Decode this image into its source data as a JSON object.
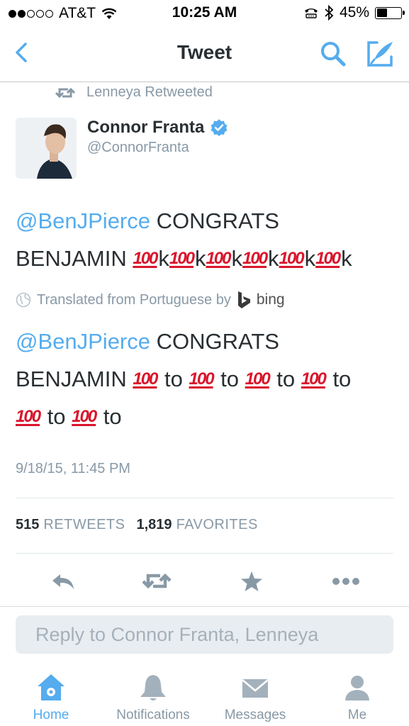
{
  "status_bar": {
    "signal_dots_filled": 2,
    "signal_dots_total": 5,
    "carrier": "AT&T",
    "time": "10:25 AM",
    "battery_percent": "45%",
    "battery_level": 0.45
  },
  "nav": {
    "title": "Tweet",
    "back_icon": "chevron-left-icon",
    "search_icon": "search-icon",
    "compose_icon": "compose-icon",
    "accent_color": "#55acee"
  },
  "tweet": {
    "retweeted_by": "Lenneya Retweeted",
    "author_name": "Connor Franta",
    "author_handle": "@ConnorFranta",
    "verified": true,
    "original": {
      "mention": "@BenJPierce",
      "line1_rest": " CONGRATS",
      "line2_start": "BENJAMIN ",
      "emoji": "100",
      "emoji_suffix": "k",
      "emoji_repeat": 6
    },
    "translated_from": "Translated from Portuguese by",
    "bing": "bing",
    "translation": {
      "mention": "@BenJPierce",
      "line1_rest": " CONGRATS",
      "line2_start": "BENJAMIN ",
      "emoji": "100",
      "emoji_suffix": "to",
      "emoji_repeat": 6
    },
    "timestamp": "9/18/15, 11:45 PM",
    "retweets_count": "515",
    "retweets_label": "RETWEETS",
    "favorites_count": "1,819",
    "favorites_label": "FAVORITES"
  },
  "actions": [
    "reply-icon",
    "retweet-icon",
    "favorite-icon",
    "more-icon"
  ],
  "reply": {
    "placeholder": "Reply to Connor Franta, Lenneya"
  },
  "tabs": [
    {
      "label": "Home",
      "icon": "home-icon",
      "active": true
    },
    {
      "label": "Notifications",
      "icon": "bell-icon",
      "active": false
    },
    {
      "label": "Messages",
      "icon": "envelope-icon",
      "active": false
    },
    {
      "label": "Me",
      "icon": "person-icon",
      "active": false
    }
  ]
}
